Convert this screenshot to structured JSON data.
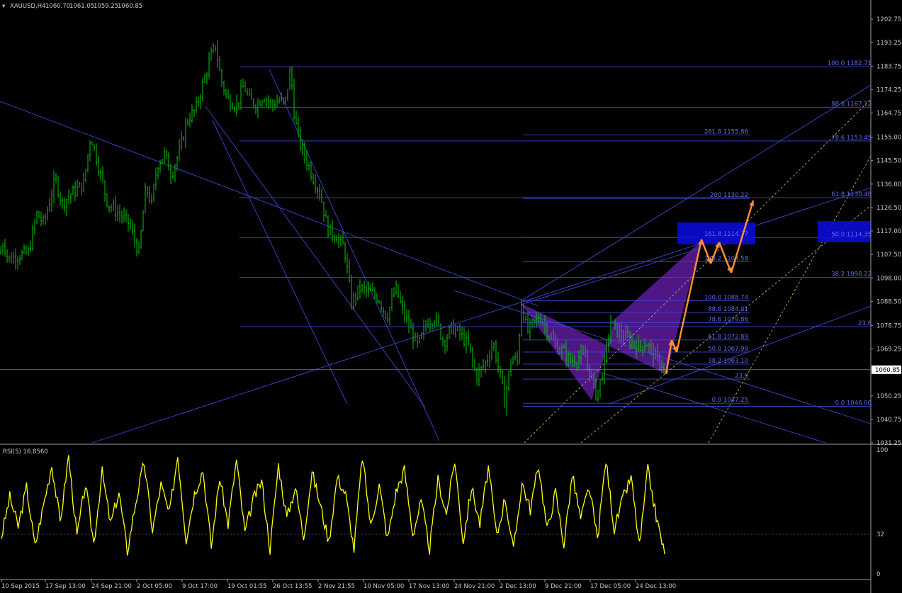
{
  "header": {
    "symbol": "XAUUSD,H4",
    "open": "1060.70",
    "high": "1061.05",
    "low": "1059.25",
    "close": "1060.85"
  },
  "current_price_label": "1060.85",
  "colors": {
    "background": "#000000",
    "candle": "#00c800",
    "grid_lines": "#3c46d2",
    "fib_text": "#5a6ee6",
    "wedge": "#6a1fb0",
    "arrows": "#ff8c3a",
    "zone": "#0b0be0",
    "rsi": "#ffff00",
    "axis_text": "#c8c8c8"
  },
  "chart_data": [
    {
      "type": "candlestick",
      "symbol": "XAUUSD",
      "timeframe": "H4",
      "ylim": [
        1031.25,
        1206.5
      ],
      "y_ticks": [
        "1202.75",
        "1193.25",
        "1183.75",
        "1174.25",
        "1164.75",
        "1155.00",
        "1145.50",
        "1136.00",
        "1126.50",
        "1117.00",
        "1107.50",
        "1098.00",
        "1088.50",
        "1078.75",
        "1069.25",
        "1060.85",
        "1050.25",
        "1040.75",
        "1031.25"
      ],
      "x_ticks": [
        "10 Sep 2015",
        "17 Sep 13:00",
        "24 Sep 21:00",
        "2 Oct 05:00",
        "9 Oct 17:00",
        "19 Oct 01:55",
        "26 Oct 13:55",
        "2 Nov 21:55",
        "10 Nov 05:00",
        "17 Nov 13:00",
        "24 Nov 21:00",
        "2 Dec 13:00",
        "9 Dec 21:00",
        "17 Dec 05:00",
        "24 Dec 13:00"
      ],
      "price_path": [
        [
          0,
          1108
        ],
        [
          5,
          1113
        ],
        [
          12,
          1105
        ],
        [
          22,
          1107
        ],
        [
          40,
          1108
        ],
        [
          52,
          1124
        ],
        [
          62,
          1120
        ],
        [
          78,
          1138
        ],
        [
          88,
          1128
        ],
        [
          100,
          1132
        ],
        [
          118,
          1136
        ],
        [
          128,
          1156
        ],
        [
          140,
          1142
        ],
        [
          152,
          1128
        ],
        [
          168,
          1124
        ],
        [
          182,
          1120
        ],
        [
          196,
          1108
        ],
        [
          206,
          1135
        ],
        [
          214,
          1128
        ],
        [
          222,
          1144
        ],
        [
          232,
          1148
        ],
        [
          242,
          1140
        ],
        [
          254,
          1150
        ],
        [
          264,
          1162
        ],
        [
          276,
          1166
        ],
        [
          284,
          1174
        ],
        [
          290,
          1180
        ],
        [
          298,
          1188
        ],
        [
          304,
          1192
        ],
        [
          312,
          1178
        ],
        [
          322,
          1170
        ],
        [
          334,
          1168
        ],
        [
          344,
          1176
        ],
        [
          352,
          1170
        ],
        [
          362,
          1168
        ],
        [
          372,
          1172
        ],
        [
          384,
          1168
        ],
        [
          394,
          1170
        ],
        [
          402,
          1168
        ],
        [
          410,
          1183
        ],
        [
          416,
          1162
        ],
        [
          424,
          1152
        ],
        [
          432,
          1146
        ],
        [
          440,
          1140
        ],
        [
          452,
          1132
        ],
        [
          462,
          1118
        ],
        [
          474,
          1115
        ],
        [
          486,
          1110
        ],
        [
          496,
          1088
        ],
        [
          508,
          1094
        ],
        [
          522,
          1092
        ],
        [
          534,
          1090
        ],
        [
          546,
          1082
        ],
        [
          558,
          1094
        ],
        [
          568,
          1085
        ],
        [
          578,
          1078
        ],
        [
          590,
          1070
        ],
        [
          602,
          1080
        ],
        [
          614,
          1082
        ],
        [
          626,
          1072
        ],
        [
          638,
          1078
        ],
        [
          650,
          1075
        ],
        [
          662,
          1070
        ],
        [
          672,
          1058
        ],
        [
          686,
          1064
        ],
        [
          696,
          1072
        ],
        [
          706,
          1058
        ],
        [
          712,
          1048
        ],
        [
          722,
          1066
        ],
        [
          730,
          1064
        ],
        [
          736,
          1088
        ],
        [
          744,
          1076
        ],
        [
          754,
          1080
        ],
        [
          764,
          1082
        ],
        [
          776,
          1074
        ],
        [
          786,
          1070
        ],
        [
          796,
          1068
        ],
        [
          806,
          1064
        ],
        [
          816,
          1066
        ],
        [
          826,
          1066
        ],
        [
          836,
          1056
        ],
        [
          842,
          1050
        ],
        [
          852,
          1062
        ],
        [
          862,
          1080
        ],
        [
          872,
          1076
        ],
        [
          882,
          1074
        ],
        [
          892,
          1072
        ],
        [
          902,
          1070
        ],
        [
          912,
          1072
        ],
        [
          920,
          1068
        ],
        [
          930,
          1064
        ],
        [
          938,
          1062
        ]
      ],
      "fib_sets": [
        {
          "name": "fib-a",
          "levels": [
            {
              "label": "100.0 1182.71",
              "price": 1183.5
            },
            {
              "label": "88.6 1167.12",
              "price": 1167.1
            },
            {
              "label": "78.6 1153.45",
              "price": 1153.45
            },
            {
              "label": "61.8 1130.48",
              "price": 1130.48
            },
            {
              "label": "50.0 1114.35",
              "price": 1114.35
            },
            {
              "label": "38.2 1098.22",
              "price": 1098.22
            },
            {
              "label": "23.6",
              "price": 1078.26
            },
            {
              "label": "0.0 1046.00",
              "price": 1046.0
            }
          ]
        },
        {
          "name": "fib-b",
          "levels": [
            {
              "label": "261.8 1155.86",
              "price": 1155.86
            },
            {
              "label": "200 1130.22",
              "price": 1130.22
            },
            {
              "label": "161.8 1114.37",
              "price": 1114.37
            },
            {
              "label": "138.2 1104.58",
              "price": 1104.58
            },
            {
              "label": "100.0 1088.74",
              "price": 1088.74
            },
            {
              "label": "88.6 1084.01",
              "price": 1084.01
            },
            {
              "label": "78.6 1079.86",
              "price": 1079.86
            },
            {
              "label": "61.8 1072.89",
              "price": 1072.89
            },
            {
              "label": "50.0 1067.99",
              "price": 1067.99
            },
            {
              "label": "38.2 1063.10",
              "price": 1063.1
            },
            {
              "label": "23.6",
              "price": 1057.05
            },
            {
              "label": "0.0 1047.25",
              "price": 1047.25
            }
          ]
        }
      ],
      "projection_path": [
        [
          1063.5,
          1057.6
        ],
        [
          1072.1,
          1068.2
        ],
        [
          1114.2,
          1101.4
        ],
        [
          1104.6,
          1113.1
        ],
        [
          1099.7,
          1129.3
        ]
      ]
    },
    {
      "type": "line",
      "title": "RSI(5) 16.8560",
      "ylim": [
        0,
        100
      ],
      "y_ticks": [
        "100",
        "32",
        "0"
      ],
      "level": 32,
      "series": [
        {
          "name": "RSI(5)",
          "values": [
            30,
            62,
            38,
            70,
            22,
            55,
            88,
            42,
            95,
            30,
            72,
            25,
            82,
            40,
            66,
            18,
            58,
            90,
            35,
            72,
            48,
            96,
            28,
            65,
            84,
            22,
            78,
            40,
            92,
            33,
            60,
            75,
            20,
            88,
            45,
            70,
            30,
            82,
            55,
            26,
            78,
            64,
            20,
            95,
            38,
            72,
            28,
            66,
            84,
            32,
            58,
            20,
            76,
            48,
            92,
            26,
            70,
            40,
            86,
            30,
            62,
            18,
            74,
            52,
            88,
            35,
            66,
            24,
            80,
            44,
            70,
            28,
            92,
            36,
            60,
            78,
            22,
            84,
            46,
            16
          ]
        }
      ]
    }
  ]
}
